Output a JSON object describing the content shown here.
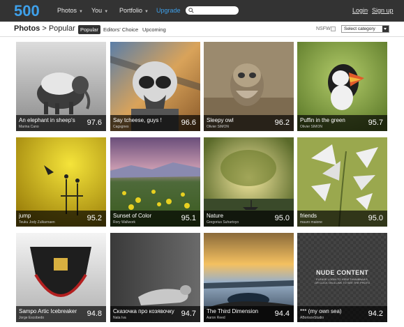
{
  "nav": {
    "logo_text": "500",
    "items": [
      {
        "label": "Photos"
      },
      {
        "label": "You"
      },
      {
        "label": "Portfolio"
      }
    ],
    "upgrade_label": "Upgrade",
    "login_label": "Login",
    "signup_label": "Sign up",
    "accent": "#3ea0ea"
  },
  "subheader": {
    "crumb_main": "Photos",
    "crumb_sep": ">",
    "crumb_current": "Popular",
    "tabs": [
      {
        "label": "Popular",
        "active": true
      },
      {
        "label": "Editors' Choice",
        "active": false
      },
      {
        "label": "Upcoming",
        "active": false
      }
    ],
    "nsfw_label": "NSFW",
    "category_select": "Select category"
  },
  "photos": [
    {
      "title": "An elephant in sheep's",
      "author": "Marina Cano",
      "score": "97.6"
    },
    {
      "title": "Say tcheese, guys !",
      "author": "Cagsgnes",
      "score": "96.6"
    },
    {
      "title": "Sleepy owl",
      "author": "Olivier SIMON",
      "score": "96.2"
    },
    {
      "title": "Puffin in the green",
      "author": "Olivier SIMON",
      "score": "95.7"
    },
    {
      "title": "jump",
      "author": "Teuku Jody Zulkarnaen",
      "score": "95.2"
    },
    {
      "title": "Sunset of Color",
      "author": "Rory Wallwork",
      "score": "95.1"
    },
    {
      "title": "Nature",
      "author": "Gregorius Suhartoyo",
      "score": "95.0"
    },
    {
      "title": "friends",
      "author": "mauro maione",
      "score": "95.0"
    },
    {
      "title": "Sampo Artic Icebreaker",
      "author": "Jorge Escobedo",
      "score": "94.8"
    },
    {
      "title": "Сказочка про козявочку",
      "author": "Nata Iva",
      "score": "94.7"
    },
    {
      "title": "The Third Dimension",
      "author": "Aaron Reed",
      "score": "94.4"
    },
    {
      "title": "*** (my own sea)",
      "author": "ABorisovStudio",
      "score": "94.2"
    }
  ],
  "nude_overlay": {
    "heading": "NUDE CONTENT",
    "line1": "PLEASE LOGIN TO VIEW THUMBNAILS,",
    "line2": "OR CLICK ON A LINK TO SEE THE PHOTO"
  }
}
